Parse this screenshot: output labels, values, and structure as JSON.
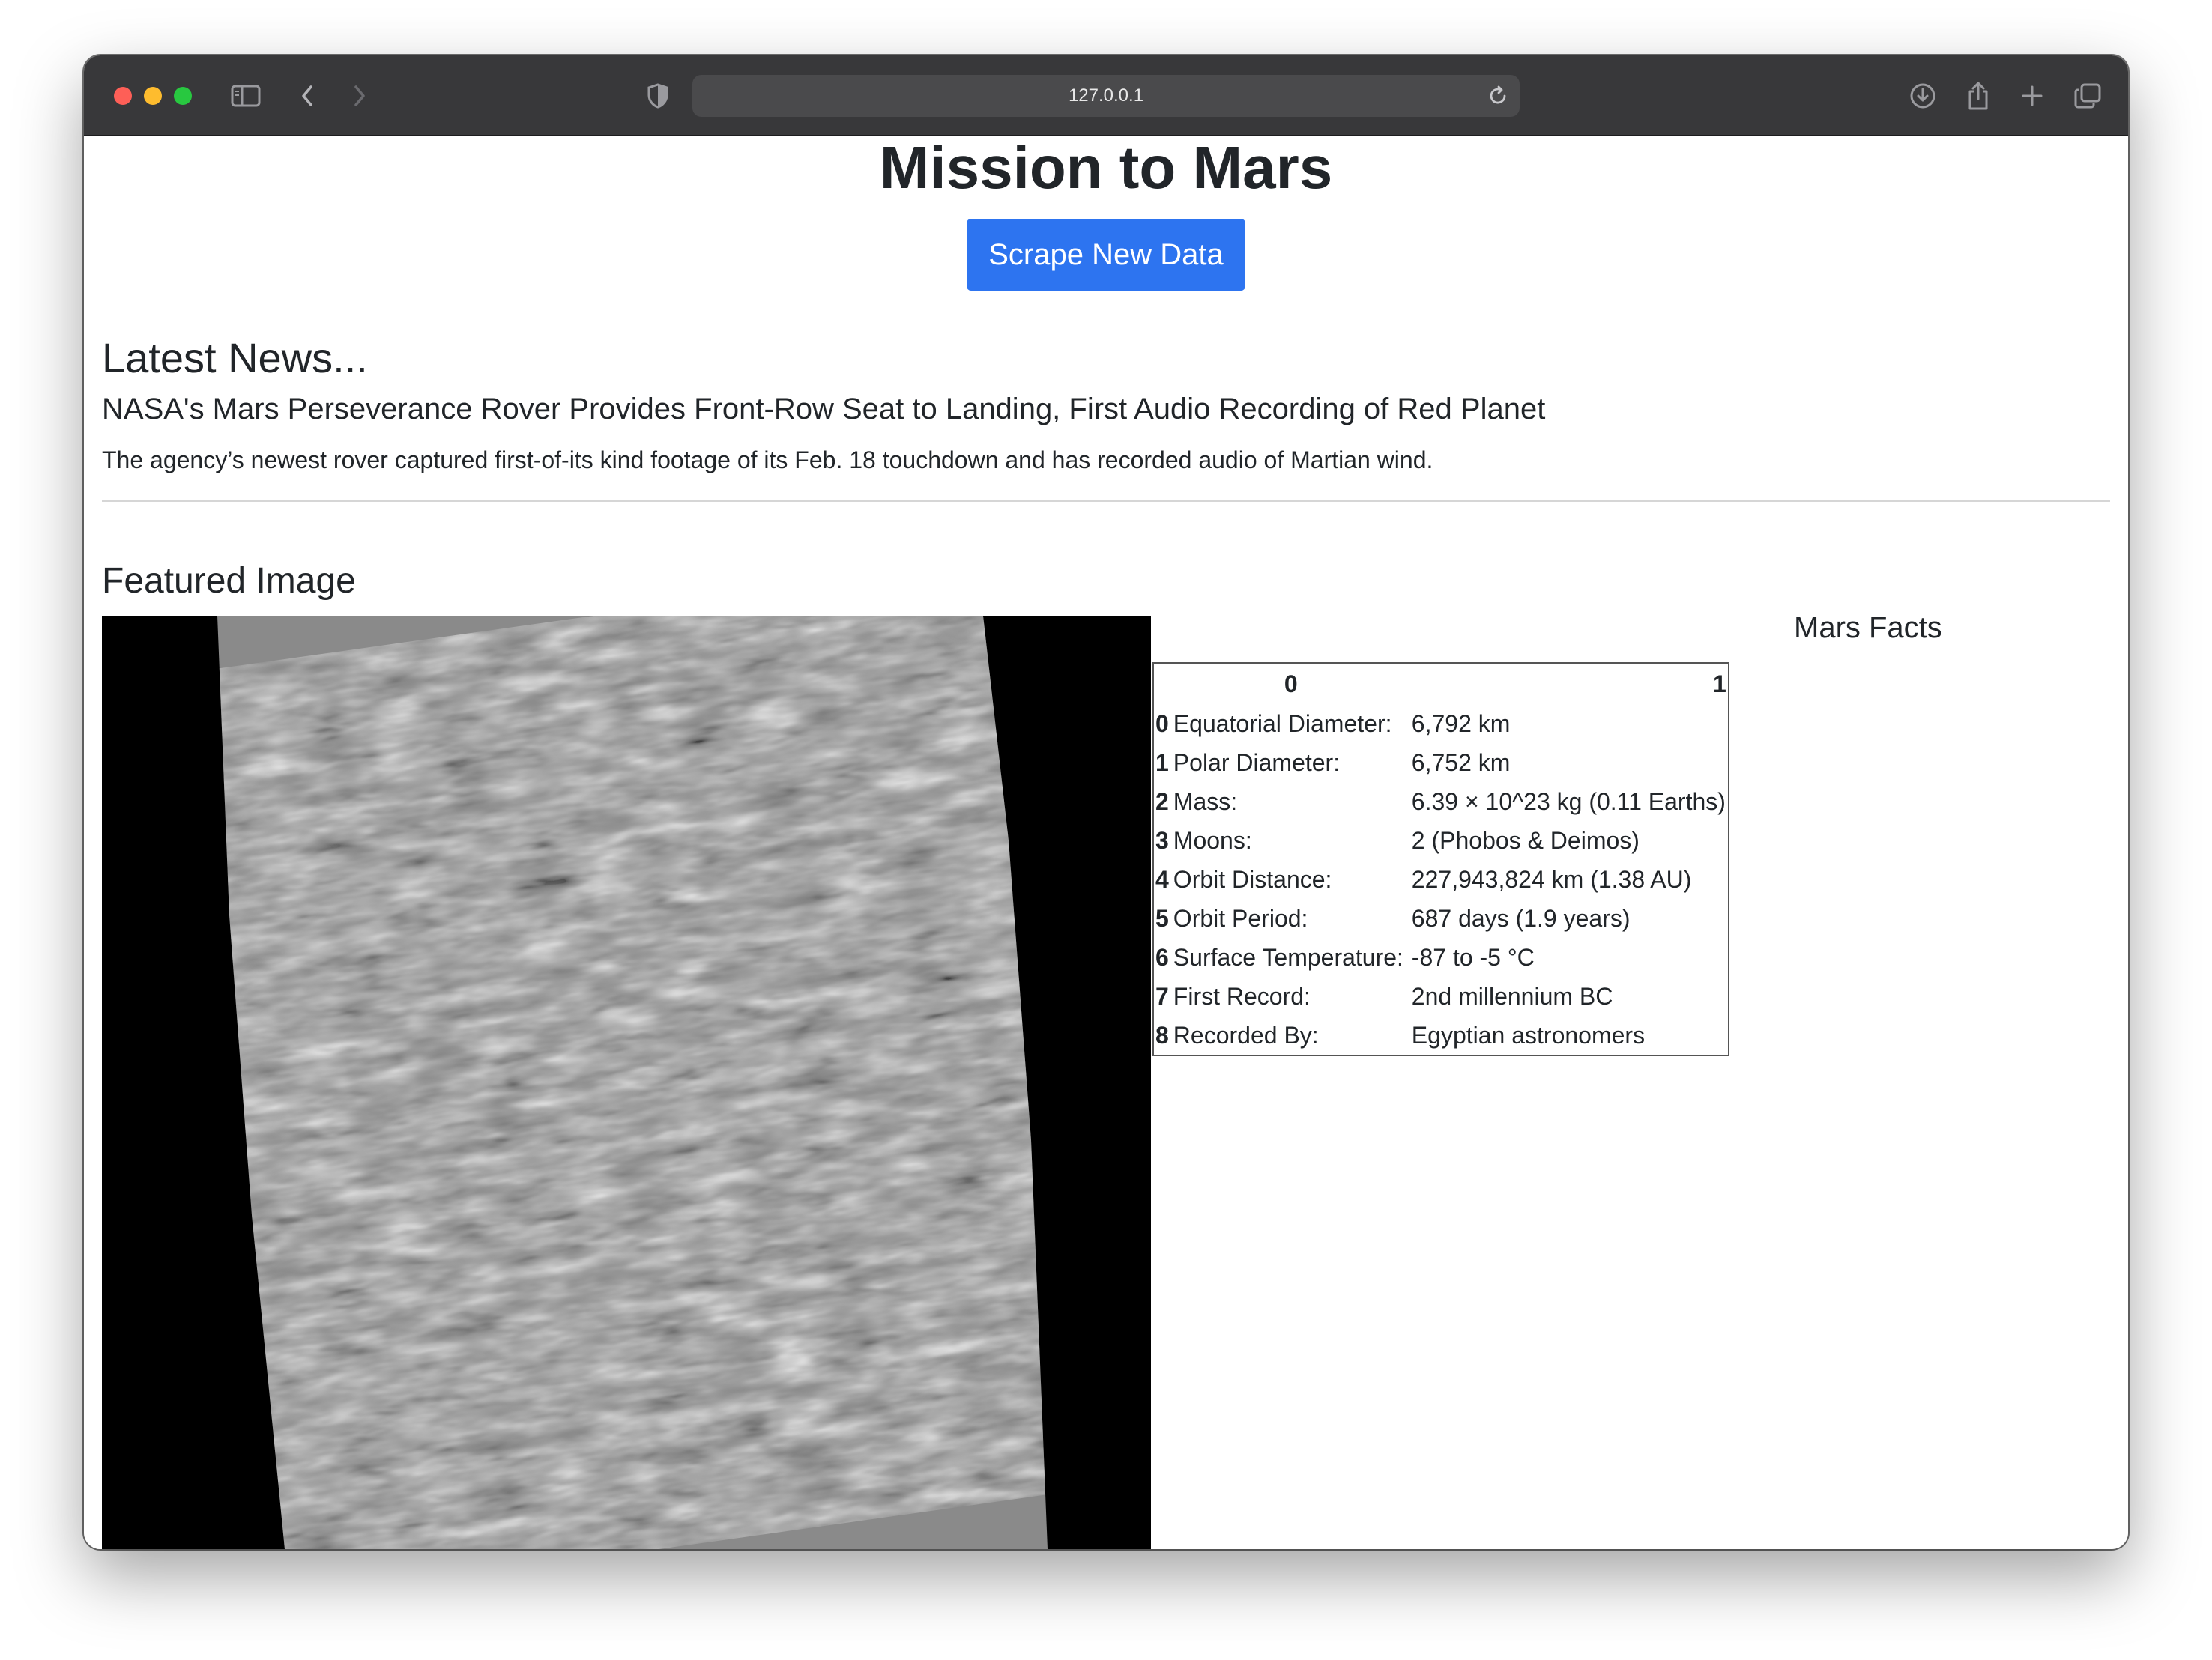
{
  "browser": {
    "url": "127.0.0.1"
  },
  "page": {
    "title": "Mission to Mars",
    "scrape_button": "Scrape New Data",
    "news": {
      "heading": "Latest News...",
      "title": "NASA's Mars Perseverance Rover Provides Front-Row Seat to Landing, First Audio Recording of Red Planet",
      "paragraph": "The agency’s newest rover captured first-of-its kind footage of its Feb. 18 touchdown and has recorded audio of Martian wind."
    },
    "featured": {
      "heading": "Featured Image"
    },
    "facts": {
      "heading": "Mars Facts",
      "columns": [
        "0",
        "1"
      ],
      "rows": [
        {
          "index": "0",
          "label": "Equatorial Diameter:",
          "value": "6,792 km"
        },
        {
          "index": "1",
          "label": "Polar Diameter:",
          "value": "6,752 km"
        },
        {
          "index": "2",
          "label": "Mass:",
          "value": "6.39 × 10^23 kg (0.11 Earths)"
        },
        {
          "index": "3",
          "label": "Moons:",
          "value": "2 (Phobos & Deimos)"
        },
        {
          "index": "4",
          "label": "Orbit Distance:",
          "value": "227,943,824 km (1.38 AU)"
        },
        {
          "index": "5",
          "label": "Orbit Period:",
          "value": "687 days (1.9 years)"
        },
        {
          "index": "6",
          "label": "Surface Temperature:",
          "value": "-87 to -5 °C"
        },
        {
          "index": "7",
          "label": "First Record:",
          "value": "2nd millennium BC"
        },
        {
          "index": "8",
          "label": "Recorded By:",
          "value": "Egyptian astronomers"
        }
      ]
    }
  }
}
